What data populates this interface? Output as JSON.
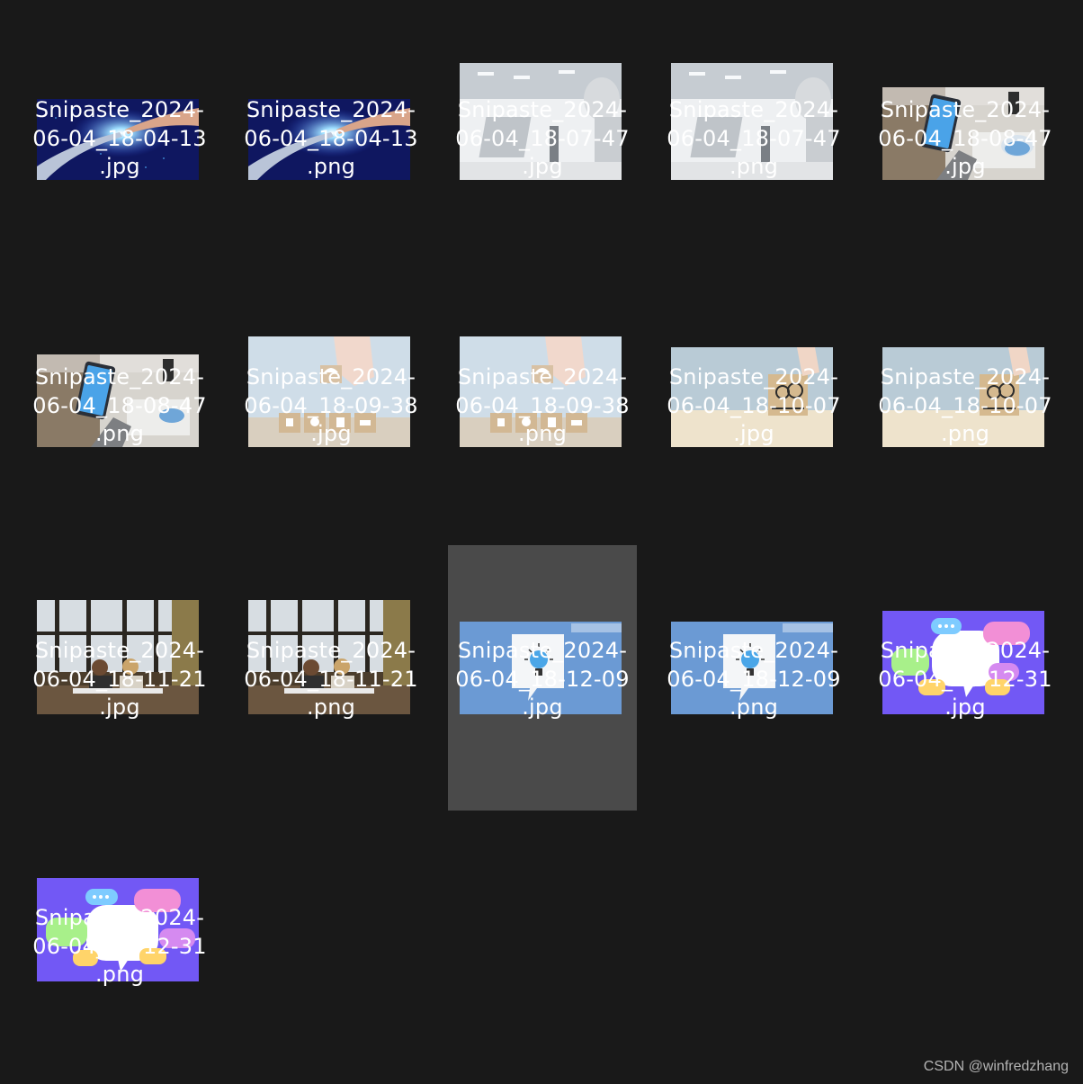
{
  "watermark": "CSDN @winfredzhang",
  "files": [
    {
      "line1": "Snipaste_2024-",
      "line2": "06-04_18-04-13",
      "line3": ".jpg",
      "thumb": "ai-hand",
      "selected": false
    },
    {
      "line1": "Snipaste_2024-",
      "line2": "06-04_18-04-13",
      "line3": ".png",
      "thumb": "ai-hand",
      "selected": false
    },
    {
      "line1": "Snipaste_2024-",
      "line2": "06-04_18-07-47",
      "line3": ".jpg",
      "thumb": "robot",
      "selected": false
    },
    {
      "line1": "Snipaste_2024-",
      "line2": "06-04_18-07-47",
      "line3": ".png",
      "thumb": "robot",
      "selected": false
    },
    {
      "line1": "Snipaste_2024-",
      "line2": "06-04_18-08-47",
      "line3": ".jpg",
      "thumb": "phone",
      "selected": false
    },
    {
      "line1": "Snipaste_2024-",
      "line2": "06-04_18-08-47",
      "line3": ".png",
      "thumb": "phone",
      "selected": false
    },
    {
      "line1": "Snipaste_2024-",
      "line2": "06-04_18-09-38",
      "line3": ".jpg",
      "thumb": "blocks",
      "selected": false
    },
    {
      "line1": "Snipaste_2024-",
      "line2": "06-04_18-09-38",
      "line3": ".png",
      "thumb": "blocks",
      "selected": false
    },
    {
      "line1": "Snipaste_2024-",
      "line2": "06-04_18-10-07",
      "line3": ".jpg",
      "thumb": "gears",
      "selected": false
    },
    {
      "line1": "Snipaste_2024-",
      "line2": "06-04_18-10-07",
      "line3": ".png",
      "thumb": "gears",
      "selected": false
    },
    {
      "line1": "Snipaste_2024-",
      "line2": "06-04_18-11-21",
      "line3": ".jpg",
      "thumb": "office",
      "selected": false
    },
    {
      "line1": "Snipaste_2024-",
      "line2": "06-04_18-11-21",
      "line3": ".png",
      "thumb": "office",
      "selected": false
    },
    {
      "line1": "Snipaste_2024-",
      "line2": "06-04_18-12-09",
      "line3": ".jpg",
      "thumb": "bulb",
      "selected": true
    },
    {
      "line1": "Snipaste_2024-",
      "line2": "06-04_18-12-09",
      "line3": ".png",
      "thumb": "bulb",
      "selected": false
    },
    {
      "line1": "Snipaste_2024-",
      "line2": "06-04_18-12-31",
      "line3": ".jpg",
      "thumb": "chat",
      "selected": false
    },
    {
      "line1": "Snipaste_2024-",
      "line2": "06-04_18-12-31",
      "line3": ".png",
      "thumb": "chat",
      "selected": false
    }
  ]
}
